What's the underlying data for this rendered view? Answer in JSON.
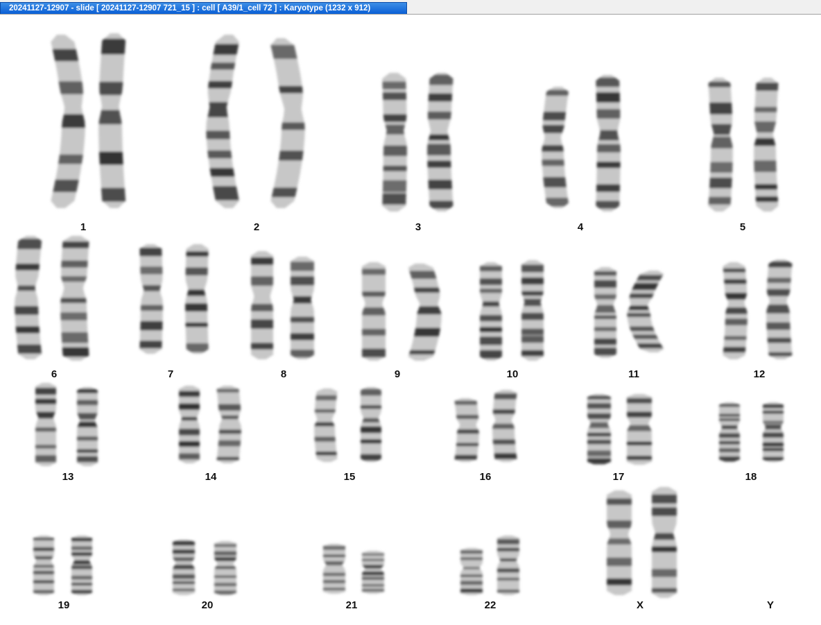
{
  "window": {
    "title": "20241127-12907 - slide [ 20241127-12907 721_15 ] : cell [ A39/1_cell 72 ] : Karyotype  (1232 x 912)"
  },
  "chromosomes": [
    {
      "label": "1",
      "icon": "chromosome-pair"
    },
    {
      "label": "2",
      "icon": "chromosome-pair"
    },
    {
      "label": "3",
      "icon": "chromosome-pair"
    },
    {
      "label": "4",
      "icon": "chromosome-pair"
    },
    {
      "label": "5",
      "icon": "chromosome-pair"
    },
    {
      "label": "6",
      "icon": "chromosome-pair"
    },
    {
      "label": "7",
      "icon": "chromosome-pair"
    },
    {
      "label": "8",
      "icon": "chromosome-pair"
    },
    {
      "label": "9",
      "icon": "chromosome-pair"
    },
    {
      "label": "10",
      "icon": "chromosome-pair"
    },
    {
      "label": "11",
      "icon": "chromosome-pair"
    },
    {
      "label": "12",
      "icon": "chromosome-pair"
    },
    {
      "label": "13",
      "icon": "chromosome-pair"
    },
    {
      "label": "14",
      "icon": "chromosome-pair"
    },
    {
      "label": "15",
      "icon": "chromosome-pair"
    },
    {
      "label": "16",
      "icon": "chromosome-pair"
    },
    {
      "label": "17",
      "icon": "chromosome-pair"
    },
    {
      "label": "18",
      "icon": "chromosome-pair"
    },
    {
      "label": "19",
      "icon": "chromosome-pair"
    },
    {
      "label": "20",
      "icon": "chromosome-pair"
    },
    {
      "label": "21",
      "icon": "chromosome-pair"
    },
    {
      "label": "22",
      "icon": "chromosome-pair"
    },
    {
      "label": "X",
      "icon": "chromosome-pair"
    },
    {
      "label": "Y",
      "icon": "empty-slot"
    }
  ],
  "colors": {
    "title_bar": "#0a5fd6",
    "chromosome_light": "#bdbdbd",
    "chromosome_dark": "#1a1a1a"
  }
}
